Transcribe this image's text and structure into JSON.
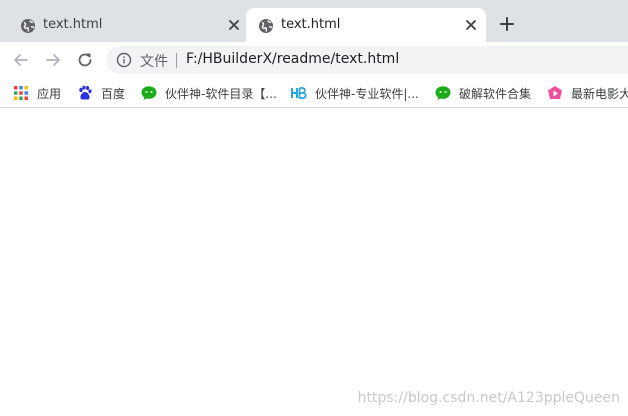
{
  "tabs": [
    {
      "title": "text.html",
      "active": false
    },
    {
      "title": "text.html",
      "active": true
    }
  ],
  "toolbar": {
    "scheme_label": "文件",
    "url": "F:/HBuilderX/readme/text.html"
  },
  "bookmarks": [
    {
      "label": "应用",
      "icon": "apps-grid-icon"
    },
    {
      "label": "百度",
      "icon": "baidu-paw-icon"
    },
    {
      "label": "伙伴神-软件目录【...",
      "icon": "wechat-icon"
    },
    {
      "label": "伙伴神-专业软件|...",
      "icon": "hbuilder-icon"
    },
    {
      "label": "破解软件合集",
      "icon": "wechat-icon"
    },
    {
      "label": "最新电影大",
      "icon": "movie-icon"
    }
  ],
  "page": {
    "watermark": "https://blog.csdn.net/A123ppleQueen"
  },
  "colors": {
    "tabstrip_bg": "#dee1e6",
    "omnibox_bg": "#f1f3f4",
    "wechat_green": "#1aad19",
    "baidu_blue": "#2932e1",
    "hbuilder_blue": "#2aa6de",
    "movie_pink": "#ef4f9c"
  }
}
